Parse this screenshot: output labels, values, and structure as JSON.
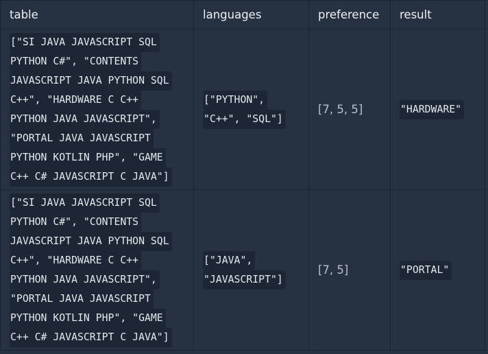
{
  "table": {
    "headers": [
      "table",
      "languages",
      "preference",
      "result"
    ],
    "rows": [
      {
        "table_lines": [
          "[\"SI JAVA JAVASCRIPT SQL",
          "PYTHON C#\", \"CONTENTS",
          "JAVASCRIPT JAVA PYTHON SQL",
          "C++\", \"HARDWARE C C++",
          "PYTHON JAVA JAVASCRIPT\",",
          "\"PORTAL JAVA JAVASCRIPT",
          "PYTHON KOTLIN PHP\", \"GAME",
          "C++ C# JAVASCRIPT C JAVA\"]"
        ],
        "languages_lines": [
          "[\"PYTHON\",",
          "\"C++\", \"SQL\"]"
        ],
        "preference": "[7, 5, 5]",
        "result": "\"HARDWARE\""
      },
      {
        "table_lines": [
          "[\"SI JAVA JAVASCRIPT SQL",
          "PYTHON C#\", \"CONTENTS",
          "JAVASCRIPT JAVA PYTHON SQL",
          "C++\", \"HARDWARE C C++",
          "PYTHON JAVA JAVASCRIPT\",",
          "\"PORTAL JAVA JAVASCRIPT",
          "PYTHON KOTLIN PHP\", \"GAME",
          "C++ C# JAVASCRIPT C JAVA\"]"
        ],
        "languages_lines": [
          "[\"JAVA\",",
          "\"JAVASCRIPT\"]"
        ],
        "preference": "[7, 5]",
        "result": "\"PORTAL\""
      }
    ]
  }
}
